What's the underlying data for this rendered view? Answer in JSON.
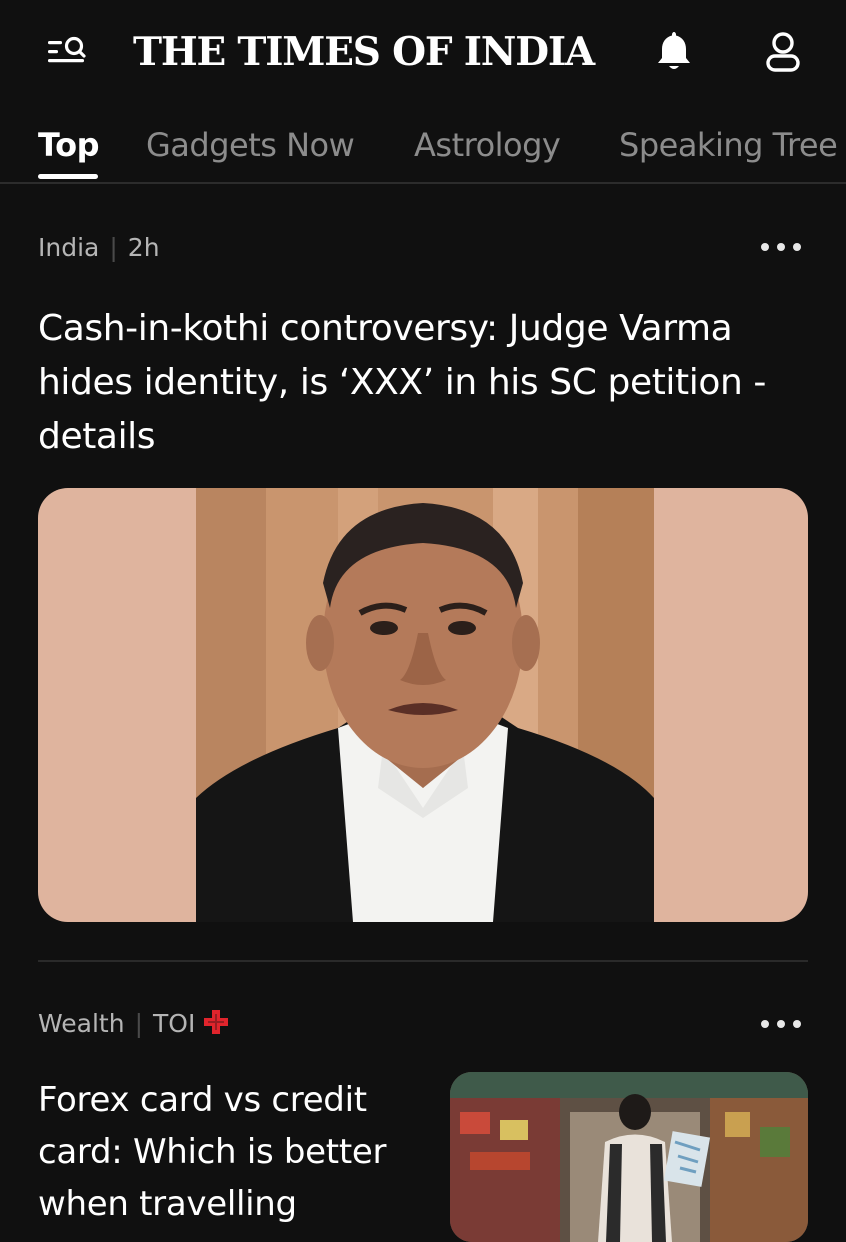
{
  "header": {
    "logo": "THE TIMES OF INDIA",
    "menu_icon": "menu-search-icon",
    "bell_icon": "bell-icon",
    "user_icon": "user-icon"
  },
  "tabs": [
    {
      "label": "Top",
      "active": true
    },
    {
      "label": "Gadgets Now",
      "active": false
    },
    {
      "label": "Astrology",
      "active": false
    },
    {
      "label": "Speaking Tree",
      "active": false
    }
  ],
  "articles": [
    {
      "section": "India",
      "time": "2h",
      "headline": "Cash-in-kothi controversy: Judge Varma hides identity, is ‘XXX’ in his SC petition - details",
      "image_desc": "portrait of a man in black judicial robe with white collar bands",
      "more_icon": "more-dots-icon"
    },
    {
      "section": "Wealth",
      "source": "TOI",
      "badge_icon": "toi-plus-icon",
      "headline": "Forex card vs credit card: Which is better when travelling",
      "image_desc": "woman with backpack holding a map in a busy market street",
      "more_icon": "more-dots-icon"
    }
  ],
  "colors": {
    "background": "#101010",
    "text": "#ffffff",
    "muted": "#8c8c8c",
    "hero_bg": "#dfb49e",
    "toi_plus_red": "#e0242c"
  }
}
